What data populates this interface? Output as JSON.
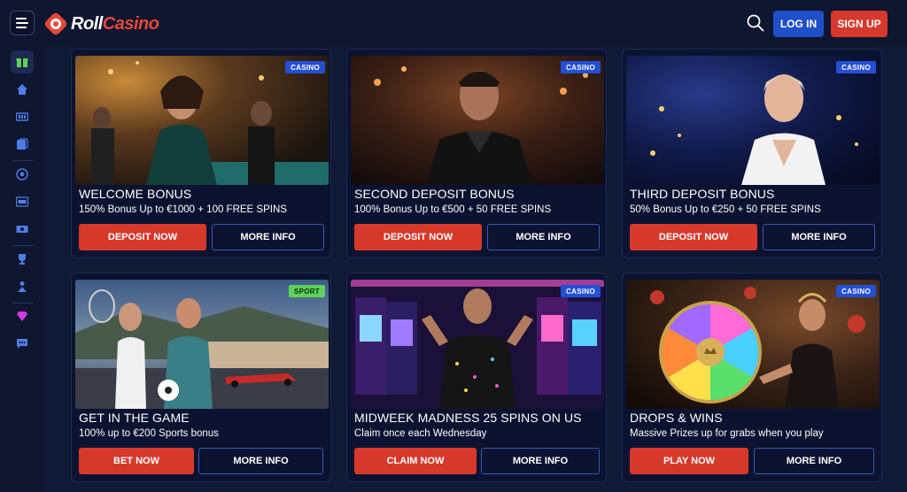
{
  "header": {
    "logo_part1": "Roll",
    "logo_part2": "Casino",
    "login_label": "LOG IN",
    "signup_label": "SIGN UP"
  },
  "sidebar": {
    "items": [
      {
        "icon": "gift-icon"
      },
      {
        "icon": "home-icon"
      },
      {
        "icon": "slots-icon"
      },
      {
        "icon": "live-casino-icon"
      },
      {
        "icon": "soccer-ball-icon"
      },
      {
        "icon": "live-icon"
      },
      {
        "icon": "ticket-icon"
      },
      {
        "icon": "trophy-icon"
      },
      {
        "icon": "tournament-icon"
      },
      {
        "icon": "vip-diamond-icon"
      },
      {
        "icon": "chat-icon"
      }
    ]
  },
  "colors": {
    "brand_red": "#d6392c",
    "brand_blue": "#1f50c8",
    "background": "#101935",
    "sport_badge": "#5ed15b"
  },
  "promos": [
    {
      "badge": "CASINO",
      "title": "WELCOME BONUS",
      "subtitle": "150% Bonus Up to €1000 + 100 FREE SPINS",
      "primary": "DEPOSIT NOW",
      "secondary": "MORE INFO"
    },
    {
      "badge": "CASINO",
      "title": "SECOND DEPOSIT BONUS",
      "subtitle": "100% Bonus Up to €500 + 50 FREE SPINS",
      "primary": "DEPOSIT NOW",
      "secondary": "MORE INFO"
    },
    {
      "badge": "CASINO",
      "title": "THIRD DEPOSIT BONUS",
      "subtitle": "50% Bonus Up to €250 + 50 FREE SPINS",
      "primary": "DEPOSIT NOW",
      "secondary": "MORE INFO"
    },
    {
      "badge": "SPORT",
      "title": "GET IN THE GAME",
      "subtitle": "100% up to €200 Sports bonus",
      "primary": "BET NOW",
      "secondary": "MORE INFO"
    },
    {
      "badge": "CASINO",
      "title": "MIDWEEK MADNESS 25 SPINS ON US",
      "subtitle": "Claim once each Wednesday",
      "primary": "CLAIM NOW",
      "secondary": "MORE INFO"
    },
    {
      "badge": "CASINO",
      "title": "DROPS & WINS",
      "subtitle": "Massive Prizes up for grabs when you play",
      "primary": "PLAY NOW",
      "secondary": "MORE INFO"
    }
  ]
}
